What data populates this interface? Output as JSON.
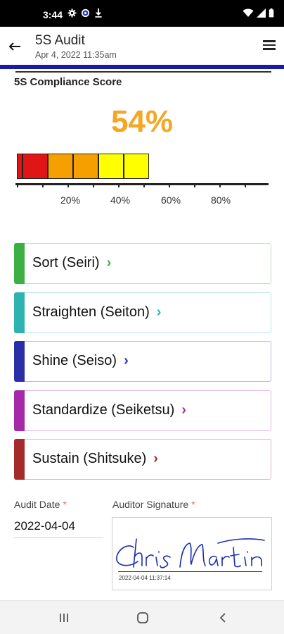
{
  "status_bar": {
    "time": "3:44",
    "left_icons": [
      "gear-icon",
      "app-notification-icon",
      "download-icon"
    ],
    "right_icons": [
      "wifi-icon",
      "signal-icon",
      "battery-icon"
    ]
  },
  "header": {
    "title": "5S Audit",
    "subtitle": "Apr 4, 2022 11:35am",
    "accent_color": "#1a1aa6"
  },
  "score": {
    "heading": "5S Compliance Score",
    "value": "54%",
    "value_color": "#f5a623",
    "level": 0.54
  },
  "gauge": {
    "segments": [
      {
        "color": "#e01515"
      },
      {
        "color": "#e01515"
      },
      {
        "color": "#f5a000"
      },
      {
        "color": "#f5a000"
      },
      {
        "color": "#ffff00"
      },
      {
        "color": "#ffff00"
      }
    ],
    "tick_labels": [
      "20%",
      "40%",
      "60%",
      "80%"
    ]
  },
  "categories": [
    {
      "label": "Sort (Seiri)",
      "chevron": "›",
      "color": "#3cb043"
    },
    {
      "label": "Straighten (Seiton)",
      "chevron": "›",
      "color": "#2fb3b0"
    },
    {
      "label": "Shine (Seiso)",
      "chevron": "›",
      "color": "#2a2fa8"
    },
    {
      "label": "Standardize (Seiketsu)",
      "chevron": "›",
      "color": "#a52aa8"
    },
    {
      "label": "Sustain (Shitsuke)",
      "chevron": "›",
      "color": "#a52a2a"
    }
  ],
  "form": {
    "audit_date_label": "Audit Date",
    "audit_date_value": "2022-04-04",
    "signature_label": "Auditor Signature",
    "required_marker": "*",
    "signature_timestamp": "2022-04-04 11:37:14"
  },
  "nav": {
    "icons": [
      "recent-apps-icon",
      "home-icon",
      "back-nav-icon"
    ]
  }
}
